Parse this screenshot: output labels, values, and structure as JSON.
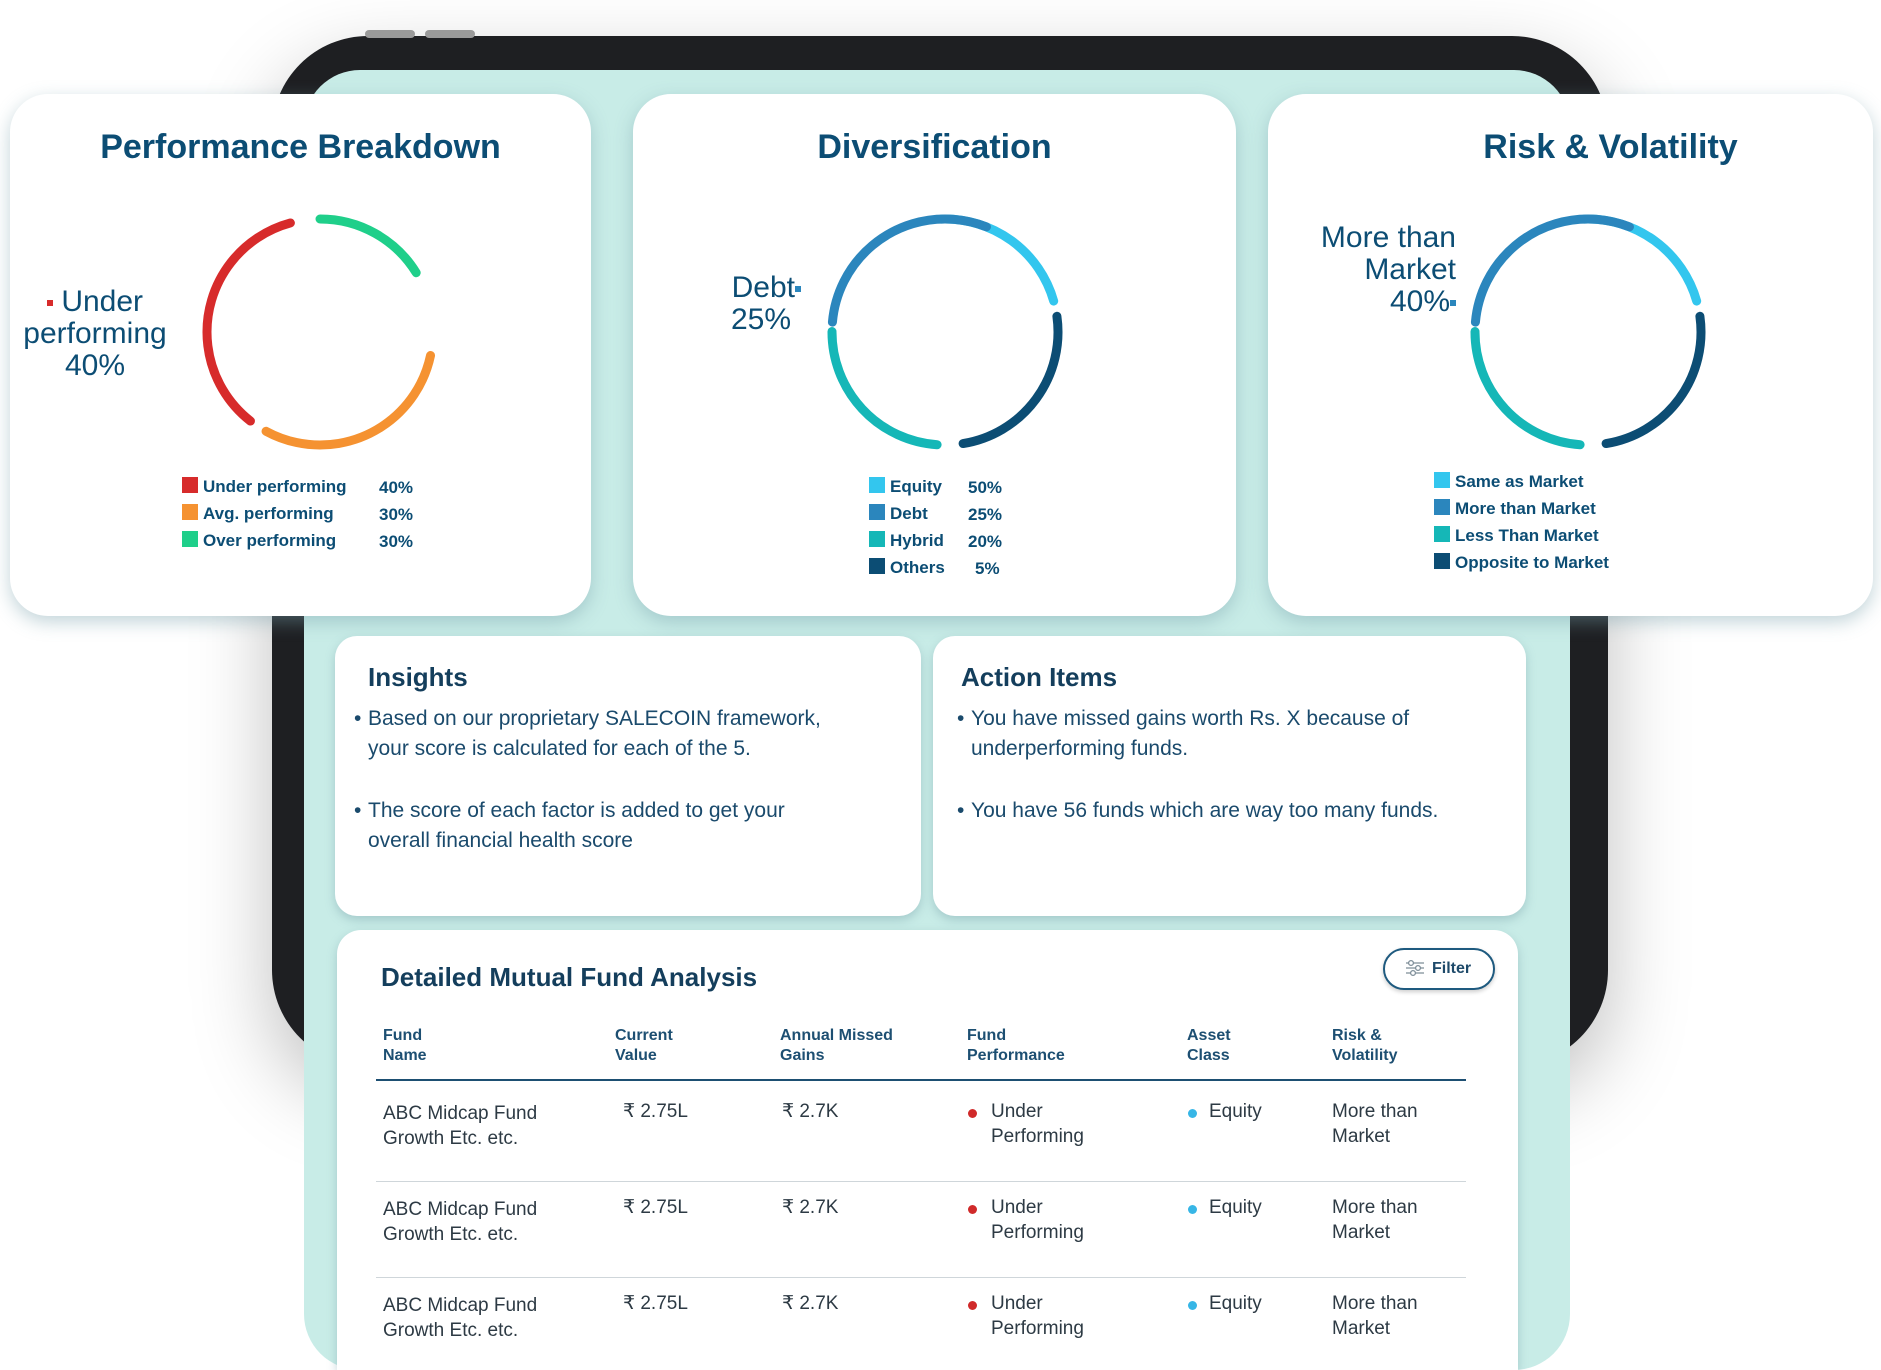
{
  "performance": {
    "title": "Performance Breakdown",
    "callout": {
      "label": "Under performing",
      "line1": "Under",
      "line2": "performing",
      "value": "40%"
    },
    "legend": [
      {
        "label": "Under performing",
        "value": "40%",
        "color": "#d72b2b"
      },
      {
        "label": "Avg. performing",
        "value": "30%",
        "color": "#f59231"
      },
      {
        "label": "Over performing",
        "value": "30%",
        "color": "#1fcf8a"
      }
    ]
  },
  "diversification": {
    "title": "Diversification",
    "callout": {
      "label": "Debt",
      "value": "25%"
    },
    "legend": [
      {
        "label": "Equity",
        "value": "50%",
        "color": "#33c6ee"
      },
      {
        "label": "Debt",
        "value": "25%",
        "color": "#2b86bd"
      },
      {
        "label": "Hybrid",
        "value": "20%",
        "color": "#15b7b7"
      },
      {
        "label": "Others",
        "value": "5%",
        "color": "#0c4d74"
      }
    ]
  },
  "risk": {
    "title": "Risk & Volatility",
    "callout": {
      "line1": "More than",
      "line2": "Market",
      "value": "40%"
    },
    "legend": [
      {
        "label": "Same as Market",
        "color": "#33c6ee"
      },
      {
        "label": "More than Market",
        "color": "#2b86bd"
      },
      {
        "label": "Less Than Market",
        "color": "#15b7b7"
      },
      {
        "label": "Opposite to Market",
        "color": "#0c4d74"
      }
    ]
  },
  "insights": {
    "title": "Insights",
    "items": [
      {
        "line1": "Based on our proprietary SALECOIN framework,",
        "line2": "your score is calculated for each of the 5."
      },
      {
        "line1": "The score of each factor is added to get your",
        "line2": "overall financial health score"
      }
    ]
  },
  "actions": {
    "title": "Action Items",
    "items": [
      {
        "line1": "You have missed gains worth Rs. X because of",
        "line2": "underperforming funds."
      },
      {
        "line1": "You have 56 funds which are way too many funds.",
        "line2": ""
      }
    ]
  },
  "table": {
    "title": "Detailed Mutual Fund Analysis",
    "filter_label": "Filter",
    "headers": [
      {
        "line1": "Fund",
        "line2": "Name"
      },
      {
        "line1": "Current",
        "line2": "Value"
      },
      {
        "line1": "Annual Missed",
        "line2": "Gains"
      },
      {
        "line1": "Fund",
        "line2": "Performance"
      },
      {
        "line1": "Asset",
        "line2": "Class"
      },
      {
        "line1": "Risk &",
        "line2": "Volatility"
      }
    ],
    "rows": [
      {
        "name1": "ABC Midcap Fund",
        "name2": "Growth Etc. etc.",
        "value": "₹ 2.75L",
        "missed": "₹ 2.7K",
        "perf1": "Under",
        "perf2": "Performing",
        "asset": "Equity",
        "risk1": "More than",
        "risk2": "Market"
      },
      {
        "name1": "ABC Midcap Fund",
        "name2": "Growth Etc. etc.",
        "value": "₹ 2.75L",
        "missed": "₹ 2.7K",
        "perf1": "Under",
        "perf2": "Performing",
        "asset": "Equity",
        "risk1": "More than",
        "risk2": "Market"
      },
      {
        "name1": "ABC Midcap Fund",
        "name2": "Growth Etc. etc.",
        "value": "₹ 2.75L",
        "missed": "₹ 2.7K",
        "perf1": "Under",
        "perf2": "Performing",
        "asset": "Equity",
        "risk1": "More than",
        "risk2": "Market"
      }
    ]
  }
}
